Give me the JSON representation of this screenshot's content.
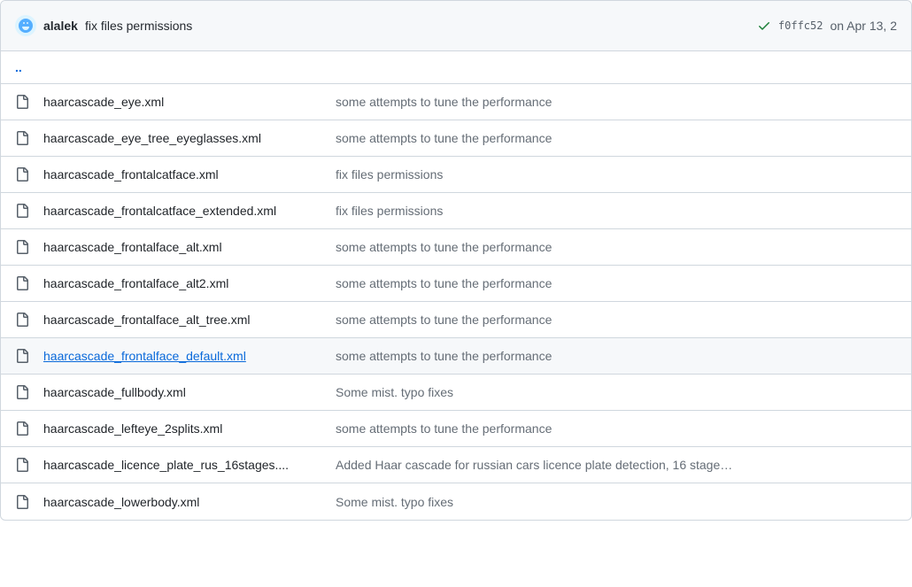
{
  "header": {
    "author": "alalek",
    "message": "fix files permissions",
    "sha": "f0ffc52",
    "date": "on Apr 13, 2"
  },
  "updir": "..",
  "files": [
    {
      "name": "haarcascade_eye.xml",
      "msg": "some attempts to tune the performance",
      "hover": false
    },
    {
      "name": "haarcascade_eye_tree_eyeglasses.xml",
      "msg": "some attempts to tune the performance",
      "hover": false
    },
    {
      "name": "haarcascade_frontalcatface.xml",
      "msg": "fix files permissions",
      "hover": false
    },
    {
      "name": "haarcascade_frontalcatface_extended.xml",
      "msg": "fix files permissions",
      "hover": false
    },
    {
      "name": "haarcascade_frontalface_alt.xml",
      "msg": "some attempts to tune the performance",
      "hover": false
    },
    {
      "name": "haarcascade_frontalface_alt2.xml",
      "msg": "some attempts to tune the performance",
      "hover": false
    },
    {
      "name": "haarcascade_frontalface_alt_tree.xml",
      "msg": "some attempts to tune the performance",
      "hover": false
    },
    {
      "name": "haarcascade_frontalface_default.xml",
      "msg": "some attempts to tune the performance",
      "hover": true
    },
    {
      "name": "haarcascade_fullbody.xml",
      "msg": "Some mist. typo fixes",
      "hover": false
    },
    {
      "name": "haarcascade_lefteye_2splits.xml",
      "msg": "some attempts to tune the performance",
      "hover": false
    },
    {
      "name": "haarcascade_licence_plate_rus_16stages....",
      "msg": "Added Haar cascade for russian cars licence plate detection, 16 stage…",
      "hover": false
    },
    {
      "name": "haarcascade_lowerbody.xml",
      "msg": "Some mist. typo fixes",
      "hover": false
    }
  ]
}
